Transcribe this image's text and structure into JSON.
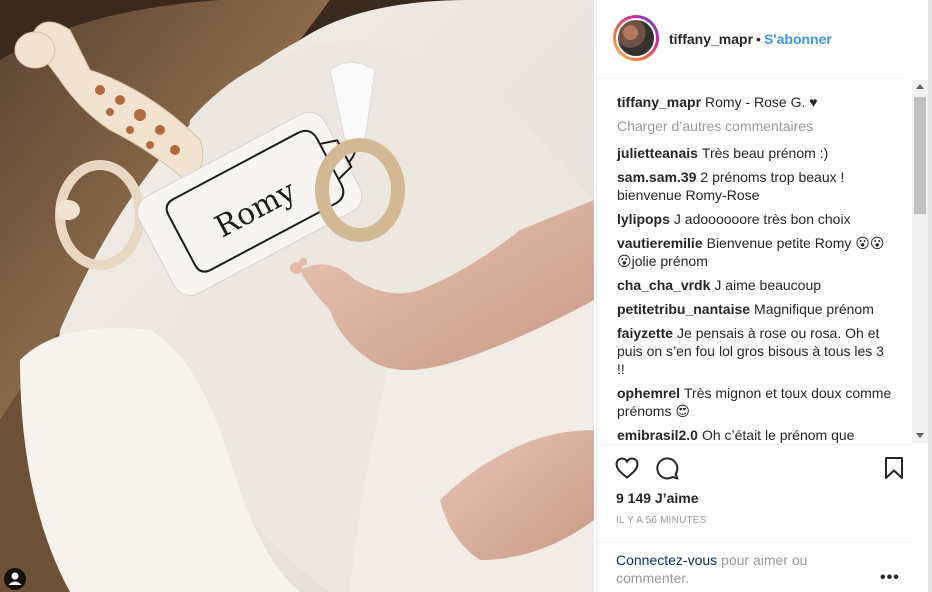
{
  "post": {
    "username": "tiffany_mapr",
    "separator": "•",
    "follow_label": "S'abonner"
  },
  "caption": {
    "username": "tiffany_mapr",
    "text": "Romy - Rose G. ♥"
  },
  "load_more_label": "Charger d’autres commentaires",
  "comments": [
    {
      "username": "juliettеanais",
      "text": "Très beau prénom :)"
    },
    {
      "username": "sam.sam.39",
      "text": "2 prénoms trop beaux ! bienvenue Romy-Rose"
    },
    {
      "username": "lylipops",
      "text": "J adoooooore très bon choix"
    },
    {
      "username": "vautieremilie",
      "text": "Bienvenue petite Romy 😮😮 😮jolie prénom"
    },
    {
      "username": "cha_cha_vrdk",
      "text": "J aime beaucoup"
    },
    {
      "username": "petitetribu_nantaise",
      "text": "Magnifique prénom"
    },
    {
      "username": "faiyzette",
      "text": "Je pensais à rose ou rosa. Oh et puis on s’en fou lol gros bisous à tous les 3 !!"
    },
    {
      "username": "ophemrel",
      "text": "Très mignon et toux doux comme prénoms 😍"
    },
    {
      "username": "emibrasil2.0",
      "text": "Oh c’était le prénom que"
    }
  ],
  "likes_label": "9 149 J’aime",
  "timestamp": "Il y a 56 minutes",
  "login": {
    "link_label": "Connectez-vous",
    "text": " pour aimer ou commenter."
  },
  "more_label": "•••",
  "photo": {
    "pillow_text": "Romy"
  },
  "colors": {
    "link_blue": "#3897f0",
    "text_dark": "#262626",
    "text_muted": "#999999"
  },
  "icons": [
    "heart-icon",
    "comment-icon",
    "bookmark-icon",
    "user-tag-icon"
  ]
}
